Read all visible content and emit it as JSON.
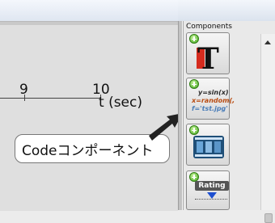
{
  "timeline": {
    "ticks": [
      "9",
      "10"
    ],
    "unit_label": "t (sec)"
  },
  "callout": {
    "text": "Codeコンポーネント"
  },
  "components_panel": {
    "title": "Components",
    "items": [
      {
        "name": "text-component",
        "icon": "text-t-icon"
      },
      {
        "name": "code-component",
        "icon": "code-icon",
        "code_lines": [
          "y=sin(x)",
          "x=random(,",
          "f='tst.jpg'"
        ]
      },
      {
        "name": "movie-component",
        "icon": "film-strip-icon"
      },
      {
        "name": "rating-component",
        "icon": "rating-icon",
        "label": "Rating"
      }
    ]
  },
  "colors": {
    "arrow": "#222222",
    "plus_icon": "#3ea31b"
  }
}
